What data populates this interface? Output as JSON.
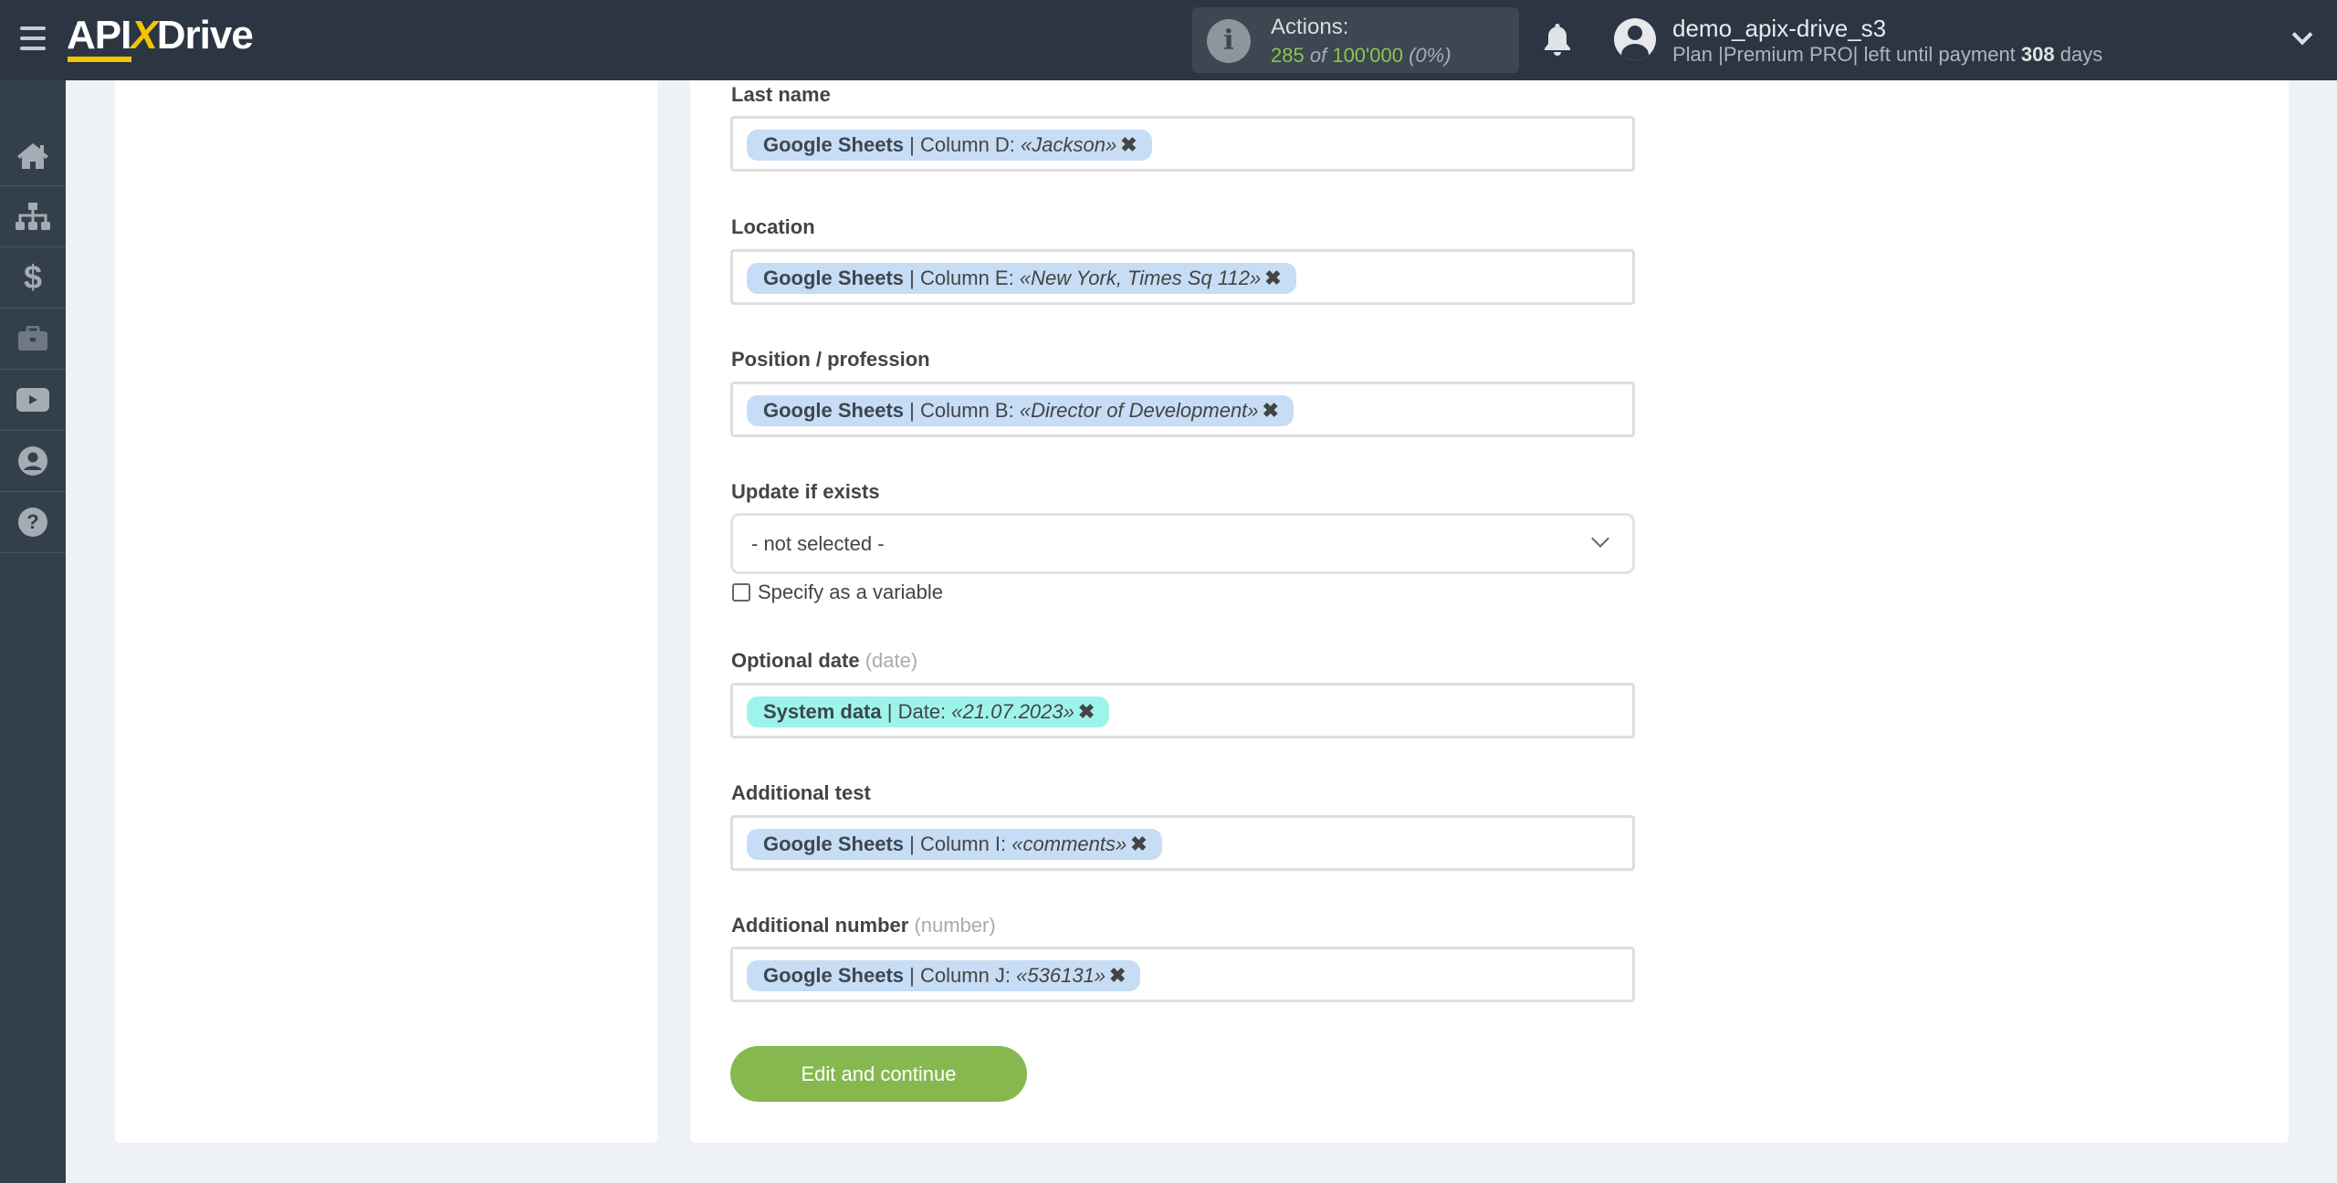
{
  "header": {
    "logo": {
      "left": "API",
      "x": "X",
      "right": "Drive"
    },
    "actions": {
      "title": "Actions:",
      "used": "285",
      "of": "of",
      "total": "100'000",
      "percent": "(0%)"
    },
    "user": {
      "name": "demo_apix-drive_s3",
      "plan_prefix": "Plan |Premium PRO| left until payment",
      "days": "308",
      "days_suffix": "days"
    }
  },
  "sidebar": {
    "items": [
      "home-icon",
      "sitemap-icon",
      "dollar-icon",
      "briefcase-icon",
      "youtube-icon",
      "user-icon",
      "help-icon"
    ]
  },
  "form": {
    "fields": [
      {
        "label": "Last name",
        "source": "Google Sheets",
        "detail": "| Column D:",
        "value": "«Jackson»"
      },
      {
        "label": "Location",
        "source": "Google Sheets",
        "detail": "| Column E:",
        "value": "«New York, Times Sq 112»"
      },
      {
        "label": "Position / profession",
        "source": "Google Sheets",
        "detail": "| Column B:",
        "value": "«Director of Development»"
      },
      {
        "label": "Optional date",
        "hint": "(date)",
        "source": "System data",
        "detail": "| Date:",
        "value": "«21.07.2023»"
      },
      {
        "label": "Additional test",
        "source": "Google Sheets",
        "detail": "| Column I:",
        "value": "«comments»"
      },
      {
        "label": "Additional number",
        "hint": "(number)",
        "source": "Google Sheets",
        "detail": "| Column J:",
        "value": "«536131»"
      }
    ],
    "update": {
      "label": "Update if exists",
      "value": "- not selected -",
      "checkbox_label": "Specify as a variable",
      "checked": false
    },
    "remove_glyph": "✖",
    "submit": "Edit and continue"
  },
  "colors": {
    "header": "#2c3642",
    "sidebar": "#343f4c",
    "chip": "#c6ddf5",
    "chip_system": "#9ef4ea",
    "button": "#86b84f",
    "accent_yellow": "#f5c400",
    "actions_green": "#8dc44f"
  }
}
